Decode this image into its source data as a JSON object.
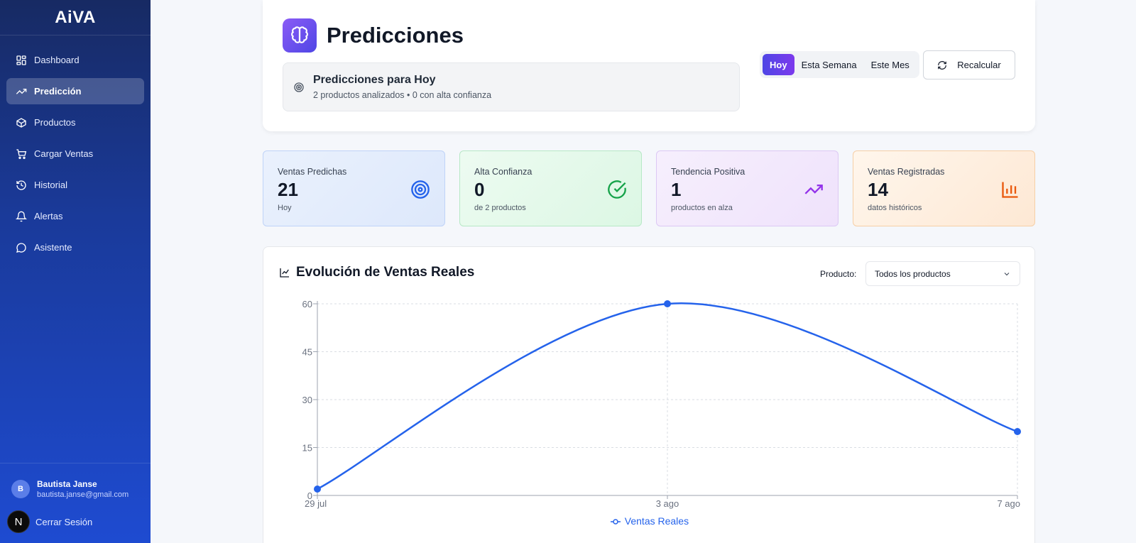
{
  "app": {
    "brand": "AiVA"
  },
  "sidebar": {
    "items": [
      {
        "label": "Dashboard",
        "icon": "dashboard-icon"
      },
      {
        "label": "Predicción",
        "icon": "trending-up-icon",
        "active": true
      },
      {
        "label": "Productos",
        "icon": "box-icon"
      },
      {
        "label": "Cargar Ventas",
        "icon": "cart-icon"
      },
      {
        "label": "Historial",
        "icon": "history-icon"
      },
      {
        "label": "Alertas",
        "icon": "bell-icon"
      },
      {
        "label": "Asistente",
        "icon": "chat-icon"
      }
    ],
    "user": {
      "initial": "B",
      "name": "Bautista Janse",
      "email": "bautista.janse@gmail.com"
    },
    "logout_badge": "N",
    "logout_label": "Cerrar Sesión"
  },
  "header": {
    "title": "Predicciones",
    "summary_title": "Predicciones para Hoy",
    "summary_sub": "2 productos analizados • 0 con alta confianza",
    "periods": [
      "Hoy",
      "Esta Semana",
      "Este Mes"
    ],
    "active_period": "Hoy",
    "recalc_label": "Recalcular"
  },
  "stats": [
    {
      "label": "Ventas Predichas",
      "value": "21",
      "sub": "Hoy",
      "icon": "target-icon",
      "color": "#2563eb"
    },
    {
      "label": "Alta Confianza",
      "value": "0",
      "sub": "de 2 productos",
      "icon": "check-circle-icon",
      "color": "#16a34a"
    },
    {
      "label": "Tendencia Positiva",
      "value": "1",
      "sub": "productos en alza",
      "icon": "trending-up-icon",
      "color": "#9333ea"
    },
    {
      "label": "Ventas Registradas",
      "value": "14",
      "sub": "datos históricos",
      "icon": "bar-chart-icon",
      "color": "#ea580c"
    }
  ],
  "chart_section": {
    "title": "Evolución de Ventas Reales",
    "product_label": "Producto:",
    "product_selected": "Todos los productos"
  },
  "chart_data": {
    "type": "line",
    "categories": [
      "29 jul",
      "3 ago",
      "7 ago"
    ],
    "series": [
      {
        "name": "Ventas Reales",
        "values": [
          2,
          60,
          20
        ],
        "color": "#2563eb"
      }
    ],
    "yticks": [
      0,
      15,
      30,
      45,
      60
    ],
    "ylim": [
      0,
      60
    ],
    "grid": true,
    "legend": "bottom"
  }
}
